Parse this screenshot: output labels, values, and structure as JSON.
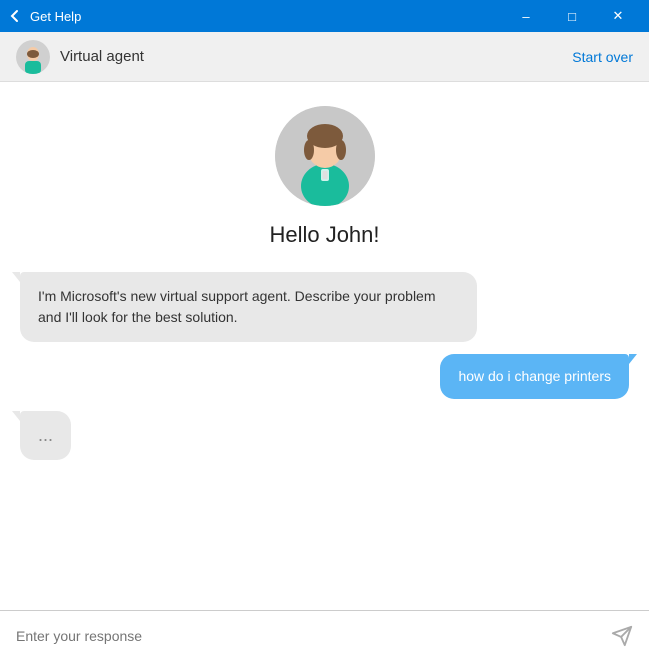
{
  "titleBar": {
    "title": "Get Help",
    "minimize": "–",
    "maximize": "□",
    "close": "✕"
  },
  "header": {
    "agentName": "Virtual agent",
    "startOver": "Start over"
  },
  "greeting": "Hello John!",
  "messages": [
    {
      "type": "bot",
      "text": "I'm Microsoft's new virtual support agent. Describe your problem and I'll look for the best solution."
    },
    {
      "type": "user",
      "text": "how do i change printers"
    },
    {
      "type": "typing",
      "text": "..."
    }
  ],
  "inputPlaceholder": "Enter your response"
}
